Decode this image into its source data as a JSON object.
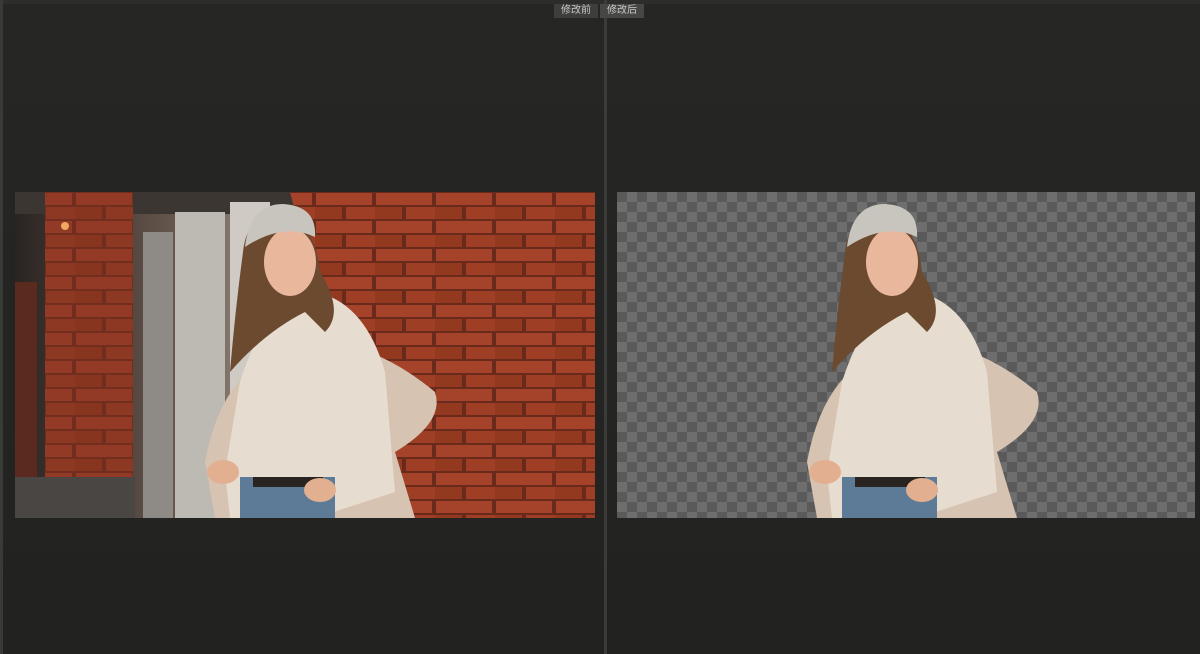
{
  "tabs": {
    "before_label": "修改前",
    "after_label": "修改后"
  },
  "colors": {
    "brick": "#9b3a22",
    "mortar": "#6a2a1b",
    "sweater": "#e6ddd0",
    "coat": "#d9c6b4",
    "hair": "#6b4a30",
    "beanie": "#c8c4be",
    "skin": "#e9b89c",
    "jeans": "#5d7a96",
    "checker_light": "#6e6e6e",
    "checker_dark": "#5a5a5a"
  },
  "icons": {
    "before_image": "photo-before-icon",
    "after_image": "photo-cutout-icon"
  }
}
